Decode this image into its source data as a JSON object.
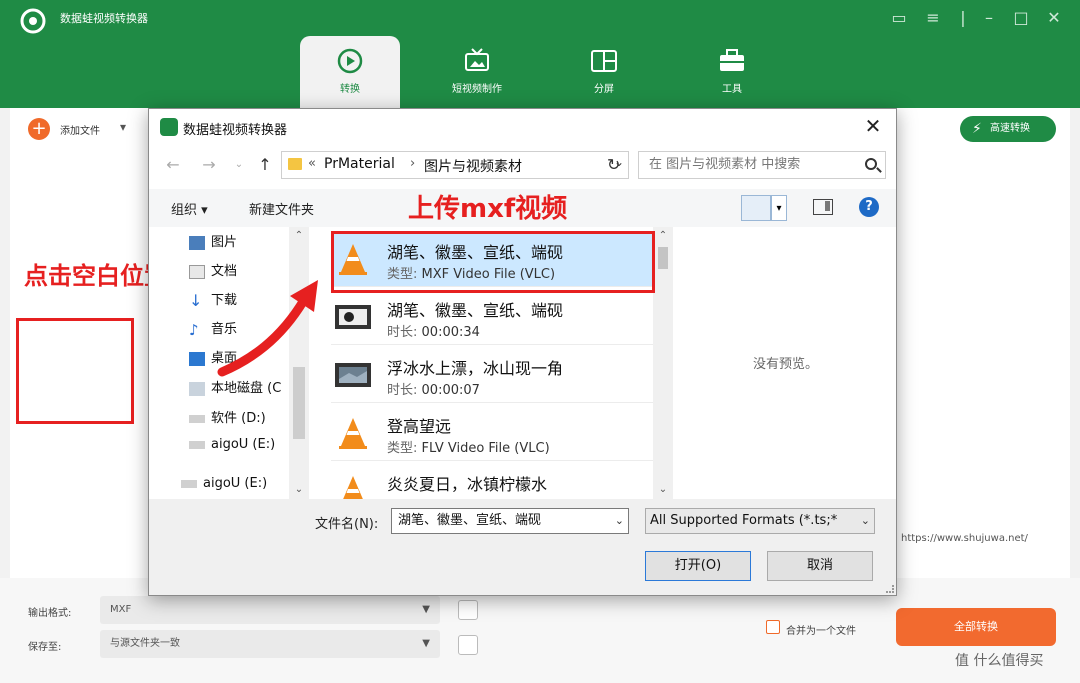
{
  "app": {
    "title": "数据蛙视频转换器",
    "tabs": [
      {
        "label": "转换",
        "icon": "convert-icon",
        "active": true
      },
      {
        "label": "短视频制作",
        "icon": "tv-icon",
        "active": false
      },
      {
        "label": "分屏",
        "icon": "split-screen-icon",
        "active": false
      },
      {
        "label": "工具",
        "icon": "toolbox-icon",
        "active": false
      }
    ],
    "add_file_label": "添加文件",
    "fast_convert_label": "高速转换",
    "url_text": "https://www.shujuwa.net/",
    "output_format_label": "输出格式:",
    "output_format_value": "MXF",
    "save_to_label": "保存至:",
    "save_to_value": "与源文件夹一致",
    "merge_label": "合并为一个文件",
    "convert_all_label": "全部转换",
    "accent_color": "#1f8b45",
    "orange_color": "#f26a2f"
  },
  "annotations": {
    "left_hint": "点击空白位置",
    "top_hint": "上传mxf视频",
    "color": "#e62020"
  },
  "dialog": {
    "title": "数据蛙视频转换器",
    "address": {
      "prefix": "«",
      "crumbs": [
        "PrMaterial",
        "图片与视频素材"
      ]
    },
    "search_placeholder": "在 图片与视频素材 中搜索",
    "toolbar": {
      "organize": "组织 ▾",
      "new_folder": "新建文件夹",
      "help": "?"
    },
    "nav_items": [
      {
        "label": "图片",
        "icon": "pictures-icon"
      },
      {
        "label": "文档",
        "icon": "documents-icon"
      },
      {
        "label": "下载",
        "icon": "download-icon"
      },
      {
        "label": "音乐",
        "icon": "music-icon"
      },
      {
        "label": "桌面",
        "icon": "desktop-icon"
      },
      {
        "label": "本地磁盘 (C",
        "icon": "disk-icon"
      },
      {
        "label": "软件 (D:)",
        "icon": "drive-icon"
      },
      {
        "label": "aigoU (E:)",
        "icon": "drive-icon"
      },
      {
        "label": "aigoU (E:)",
        "icon": "drive-icon"
      }
    ],
    "files": [
      {
        "name": "湖笔、徽墨、宣纸、端砚",
        "meta_key": "类型:",
        "meta_value": "MXF Video File (VLC)",
        "thumb": "vlc-cone-icon",
        "selected": true
      },
      {
        "name": "湖笔、徽墨、宣纸、端砚",
        "meta_key": "时长:",
        "meta_value": "00:00:34",
        "thumb": "video-thumbnail",
        "selected": false
      },
      {
        "name": "浮冰水上漂，冰山现一角",
        "meta_key": "时长:",
        "meta_value": "00:00:07",
        "thumb": "video-thumbnail",
        "selected": false
      },
      {
        "name": "登高望远",
        "meta_key": "类型:",
        "meta_value": "FLV Video File (VLC)",
        "thumb": "vlc-cone-icon",
        "selected": false
      },
      {
        "name": "炎炎夏日，冰镇柠檬水",
        "meta_key": "",
        "meta_value": "",
        "thumb": "vlc-cone-icon",
        "selected": false
      }
    ],
    "preview_text": "没有预览。",
    "filename_label": "文件名(N):",
    "filename_value": "湖笔、徽墨、宣纸、端砚",
    "filter_value": "All Supported Formats (*.ts;*",
    "open_label": "打开(O)",
    "cancel_label": "取消"
  },
  "watermark": "值 什么值得买"
}
